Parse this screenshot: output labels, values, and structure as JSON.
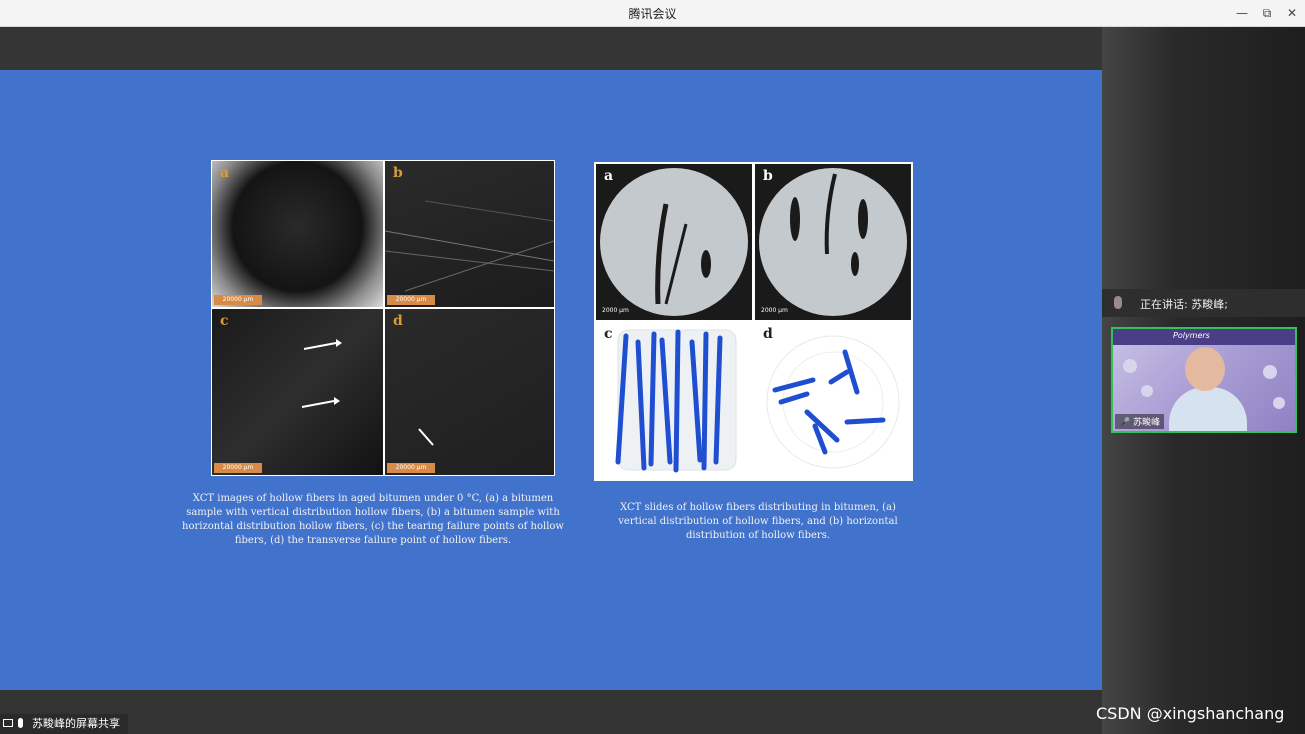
{
  "window": {
    "title": "腾讯会议",
    "minimize_icon": "minimize-icon",
    "restore_icon": "restore-icon",
    "close_icon": "close-icon"
  },
  "sidebar": {
    "speaking_text": "正在讲话: 苏畯峰;",
    "participant_name": "苏畯峰",
    "video_slide_title": "Polymers"
  },
  "slide": {
    "left_figure": {
      "panels": [
        "a",
        "b",
        "c",
        "d"
      ],
      "scalebar_label": "20000 μm",
      "caption": "XCT images of hollow fibers in aged bitumen under 0 °C, (a) a bitumen sample with vertical distribution hollow fibers, (b) a bitumen sample with horizontal distribution hollow fibers, (c) the tearing failure points of hollow fibers, (d) the transverse failure point of hollow fibers."
    },
    "right_figure": {
      "panels": [
        "a",
        "b",
        "c",
        "d"
      ],
      "scalebar_label": "2000 μm",
      "caption": "XCT slides of hollow fibers distributing in bitumen, (a) vertical distribution of hollow fibers, and (b) horizontal distribution of hollow fibers."
    }
  },
  "screen_share": {
    "label": "苏畯峰的屏幕共享"
  },
  "watermark": "CSDN @xingshanchang",
  "colors": {
    "slide_bg": "#4173cc",
    "fiber_blue": "#1f4fd0",
    "active_video_border": "#31c25a"
  }
}
